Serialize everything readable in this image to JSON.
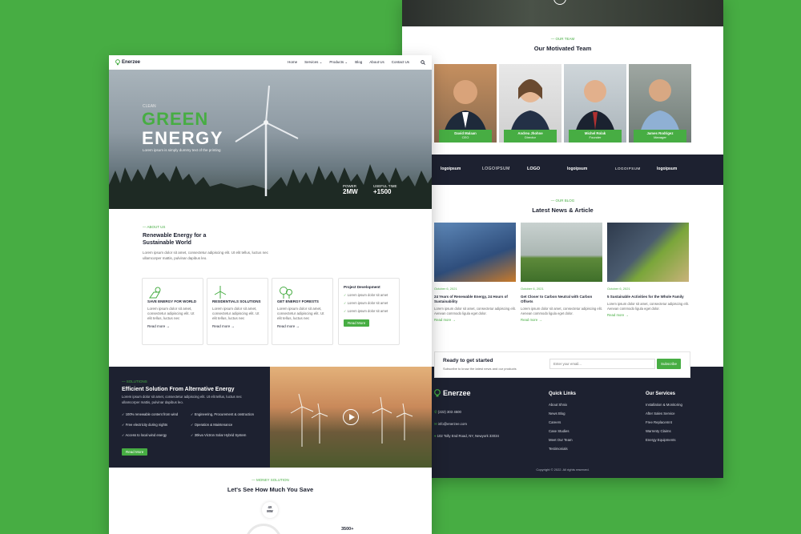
{
  "colors": {
    "accent": "#47ad43",
    "dark": "#1d2130",
    "background": "#47ad43"
  },
  "right_page": {
    "team": {
      "eyebrow": "— OUR TEAM",
      "title": "Our Motivated Team",
      "members": [
        {
          "name": "David Malaan",
          "role": "CEO"
        },
        {
          "name": "Andrea Jhohne",
          "role": "Director"
        },
        {
          "name": "Michel Rolak",
          "role": "Founder"
        },
        {
          "name": "James Rodrigez",
          "role": "Manager"
        }
      ]
    },
    "logos": [
      "logoipsum",
      "LOGOIPSUM",
      "LOGO",
      "logoipsum",
      "LOGOIPSUM",
      "logoipsum"
    ],
    "blog": {
      "eyebrow": "— OUR BLOG",
      "title": "Latest News & Article",
      "posts": [
        {
          "date": "October 6, 2021",
          "title": "24 Years of Renewable Energy, 24 Hours of Sustainability",
          "desc": "Lorem ipsum dolor sit amet, consectetur adipiscing elit. Aenean commodo ligula eget dolor.",
          "more": "Read more →"
        },
        {
          "date": "October 6, 2021",
          "title": "Get Closer to Carbon Neutral with Carbon Offsets",
          "desc": "Lorem ipsum dolor sit amet, consectetur adipiscing elit. Aenean commodo ligula eget dolor.",
          "more": "Read more →"
        },
        {
          "date": "October 6, 2021",
          "title": "5 Sustainable Activities for the Whole Family",
          "desc": "Lorem ipsum dolor sit amet, consectetur adipiscing elit. Aenean commodo ligula eget dolor.",
          "more": "Read more →"
        }
      ]
    },
    "newsletter": {
      "title": "Ready to get started",
      "subtitle": "Subscribe to know the latest news and our products",
      "placeholder": "Enter your email...",
      "button": "Subscribe"
    },
    "footer": {
      "brand": "Enerzee",
      "phone": "(222) 303 4500",
      "email": "info@enerzee.com",
      "address": "102 Tolly End Road, NY, Newyork 33034",
      "quick_title": "Quick Links",
      "quick_links": [
        "About Shnix",
        "News Blog",
        "Careers",
        "Case Studies",
        "Meet Our Team",
        "Testimonials"
      ],
      "services_title": "Our Services",
      "services": [
        "Installation & Monitoring",
        "After Sales Service",
        "Free Replacemnt",
        "Warrenty Claims",
        "Energy Equipments"
      ],
      "copyright": "Copyright © 2022. All rights reserved."
    }
  },
  "left_page": {
    "nav": {
      "brand": "Enerzee",
      "links": [
        "Home",
        "Services ⌄",
        "Products ⌄",
        "Blog",
        "About Us",
        "Contact Us"
      ]
    },
    "hero": {
      "kicker": "CLEAN",
      "title1": "GREEN",
      "title2": "ENERGY",
      "subtitle": "Lorem ipsum is simply dummy text of the printing",
      "stat1_label": "POWER",
      "stat1_value": "2MW",
      "stat2_label": "USEFUL TIME",
      "stat2_value": "+1500"
    },
    "about": {
      "eyebrow": "— ABOUT US",
      "title": "Renewable Energy for a Sustainable World",
      "text": "Lorem ipsum dolor sit amet, consectetur adipiscing elit. Ut elit tellus, luctus nec ullamcorper mattis, pulvinar dapibus leo."
    },
    "features": [
      {
        "title": "SAVE ENERGY FOR WORLD",
        "desc": "Lorem ipsum dolor sit amet, consectetur adipiscing elit. Ut elit tellus, luctus nec",
        "more": "Read more →"
      },
      {
        "title": "RESIDENTIALS SOLUTIONS",
        "desc": "Lorem ipsum dolor sit amet, consectetur adipiscing elit. Ut elit tellus, luctus nec",
        "more": "Read more →"
      },
      {
        "title": "GET ENERGY FORESTS",
        "desc": "Lorem ipsum dolor sit amet, consectetur adipiscing elit. Ut elit tellus, luctus nec",
        "more": "Read more →"
      }
    ],
    "project": {
      "title": "Project Development",
      "items": [
        "Lorem ipsum dolor sit amet",
        "Lorem ipsum dolor sit amet",
        "Lorem ipsum dolor sit amet"
      ],
      "button": "Read More"
    },
    "solutions": {
      "eyebrow": "— SOLUTIONS",
      "title": "Efficient Solution From Alternative Energy",
      "text": "Lorem ipsum dolor sit amet, consectetur adipiscing elit. Ut elit tellus, luctus nec ullamcorper mattis, pulvinar dapibus leo.",
      "checks": [
        "100% renewable content from wind",
        "Engineering, Procurement & onstruction",
        "Free electricity during nights",
        "Operation & Maintenance",
        "Access to local wind energy",
        "30kva Victron Solar Hybrid System"
      ],
      "button": "Read More"
    },
    "money": {
      "eyebrow": "— MONEY SOLUTION",
      "title": "Let's See How Much You Save",
      "badge_top": "4X",
      "badge_bottom": "MW",
      "stat": "3500+"
    }
  }
}
